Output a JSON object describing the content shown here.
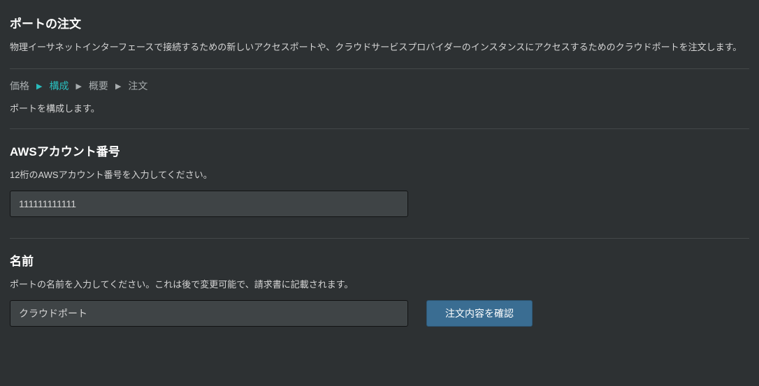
{
  "header": {
    "title": "ポートの注文",
    "description": "物理イーサネットインターフェースで接続するための新しいアクセスポートや、クラウドサービスプロバイダーのインスタンスにアクセスするためのクラウドポートを注文します。"
  },
  "breadcrumb": {
    "steps": [
      "価格",
      "構成",
      "概要",
      "注文"
    ],
    "active_index": 1,
    "description": "ポートを構成します。"
  },
  "sections": {
    "aws_account": {
      "title": "AWSアカウント番号",
      "description": "12桁のAWSアカウント番号を入力してください。",
      "input_value": "111111111111"
    },
    "name": {
      "title": "名前",
      "description": "ポートの名前を入力してください。これは後で変更可能で、請求書に記載されます。",
      "input_value": "クラウドポート"
    }
  },
  "buttons": {
    "confirm_label": "注文内容を確認"
  }
}
